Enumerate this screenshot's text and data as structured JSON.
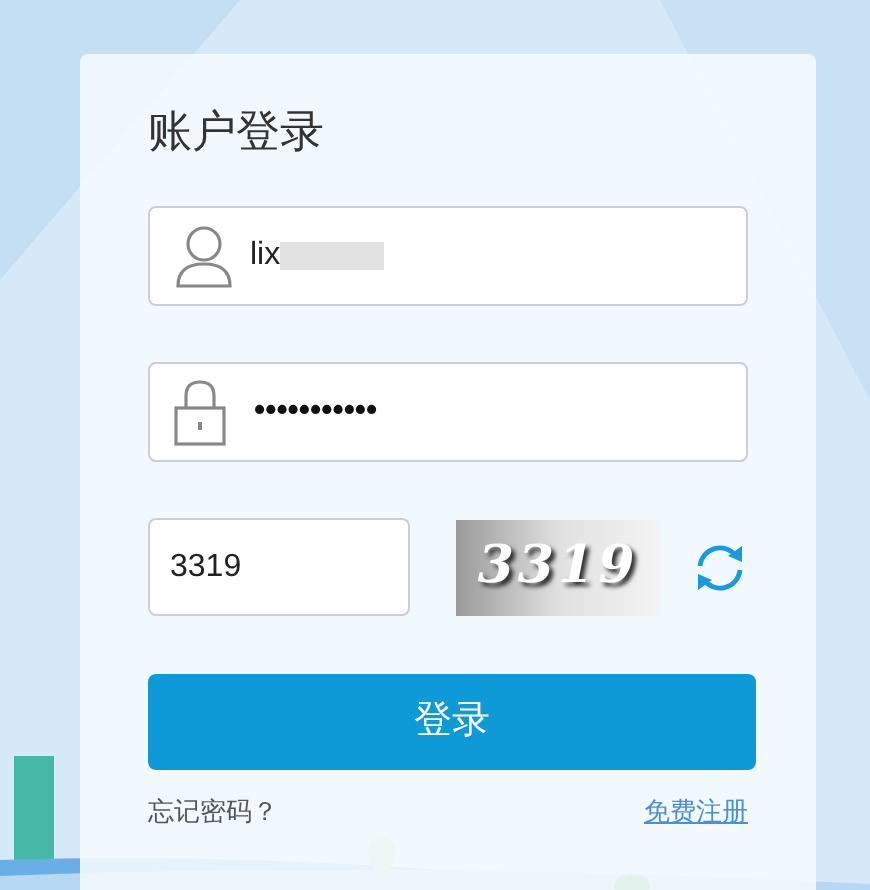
{
  "title": "账户登录",
  "username": {
    "value": "lix",
    "redacted": true
  },
  "password": {
    "value": "•••••••••••"
  },
  "captcha": {
    "value": "3319",
    "image_text": "3319"
  },
  "login_button": "登录",
  "forgot_link": "忘记密码？",
  "register_link": "免费注册"
}
